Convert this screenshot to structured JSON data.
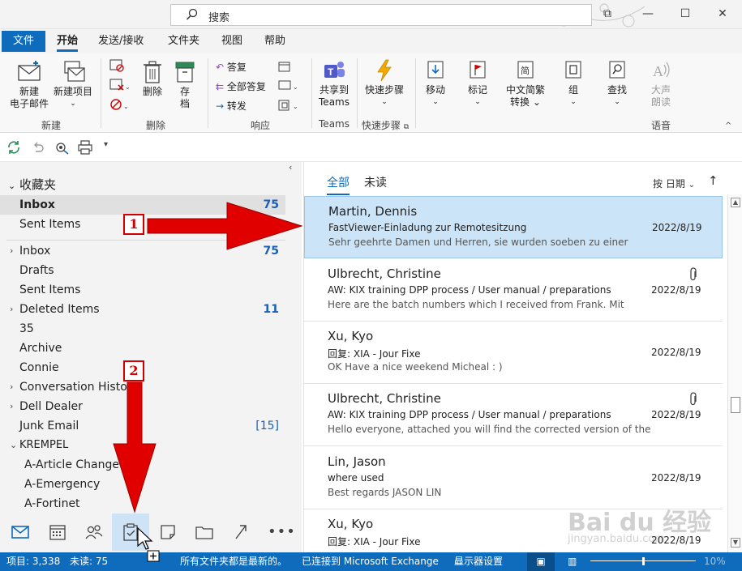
{
  "titlebar": {
    "search_placeholder": "搜索",
    "controls": {
      "restore": "⧉",
      "minimize": "—",
      "maximize": "☐",
      "close": "✕"
    }
  },
  "ribbon_tabs": [
    "文件",
    "开始",
    "发送/接收",
    "文件夹",
    "视图",
    "帮助"
  ],
  "ribbon": {
    "new_email": [
      "新建",
      "电子邮件"
    ],
    "new_item": [
      "新建项目"
    ],
    "group_new": "新建",
    "delete": "删除",
    "archive": "存\n档",
    "group_delete": "删除",
    "reply": "答复",
    "reply_all": "全部答复",
    "forward": "转发",
    "group_respond": "响应",
    "share_teams": [
      "共享到",
      "Teams"
    ],
    "group_teams": "Teams",
    "quick_steps": "快速步骤",
    "group_quick": "快速步骤",
    "move": "移动",
    "tags": "标记",
    "chinese_convert": [
      "中文简繁",
      "转换"
    ],
    "group_btn": "组",
    "find": "查找",
    "read_aloud": [
      "大声",
      "朗读"
    ],
    "group_speech": "语音"
  },
  "folders": {
    "favorites_header": "收藏夹",
    "favorites": [
      {
        "label": "Inbox",
        "count": "75",
        "selected": true
      },
      {
        "label": "Sent Items",
        "count": ""
      }
    ],
    "items": [
      {
        "label": "Inbox",
        "count": "75",
        "expandable": true
      },
      {
        "label": "Drafts",
        "count": ""
      },
      {
        "label": "Sent Items",
        "count": ""
      },
      {
        "label": "Deleted Items",
        "count": "11",
        "expandable": true
      },
      {
        "label": "35",
        "count": ""
      },
      {
        "label": "Archive",
        "count": ""
      },
      {
        "label": "Connie",
        "count": ""
      },
      {
        "label": "Conversation History",
        "count": "",
        "expandable": true
      },
      {
        "label": "Dell Dealer",
        "count": "",
        "expandable": true
      },
      {
        "label": "Junk Email",
        "count": "[15]"
      },
      {
        "label": "KREMPEL",
        "count": "",
        "expanded": true
      },
      {
        "label": "A-Article Change",
        "count": ""
      },
      {
        "label": "A-Emergency",
        "count": ""
      },
      {
        "label": "A-Fortinet",
        "count": ""
      }
    ]
  },
  "mail_list": {
    "tab_all": "全部",
    "tab_unread": "未读",
    "sort_label": "按 日期",
    "messages": [
      {
        "from": "Martin, Dennis",
        "subject": "FastViewer-Einladung zur Remotesitzung",
        "preview": "Sehr geehrte Damen und Herren,   sie wurden soeben zu einer",
        "date": "2022/8/19",
        "selected": true,
        "attachment": false
      },
      {
        "from": "Ulbrecht, Christine",
        "subject": "AW: KIX training DPP process / User manual / preparations",
        "preview": "Here are the batch numbers which I received from Frank.  Mit",
        "date": "2022/8/19",
        "attachment": true
      },
      {
        "from": "Xu, Kyo",
        "subject": "回复: XIA - Jour Fixe",
        "preview": "OK  Have a nice weekend  Micheal : )",
        "date": "2022/8/19",
        "attachment": false
      },
      {
        "from": "Ulbrecht, Christine",
        "subject": "AW: KIX training DPP process / User manual / preparations",
        "preview": "Hello everyone,  attached you will find the corrected version of the",
        "date": "2022/8/19",
        "attachment": true
      },
      {
        "from": "Lin, Jason",
        "subject": "where used",
        "preview": "Best regards    JASON LIN",
        "date": "2022/8/19",
        "attachment": false
      },
      {
        "from": "Xu, Kyo",
        "subject": "回复: XIA - Jour Fixe",
        "preview": "",
        "date": "2022/8/19",
        "attachment": false
      }
    ]
  },
  "statusbar": {
    "items": "项目: 3,338",
    "unread": "未读: 75",
    "uptodate": "所有文件夹都是最新的。",
    "connected": "已连接到 Microsoft Exchange",
    "display_settings": "显示器设置",
    "zoom": "10%"
  },
  "annotations": {
    "one": "1",
    "two": "2"
  },
  "watermark": {
    "main": "Bai du 经验",
    "sub": "jingyan.baidu.com"
  },
  "colors": {
    "accent": "#0f6cbd",
    "selection": "#cce4f7",
    "annotation": "#d00000"
  }
}
